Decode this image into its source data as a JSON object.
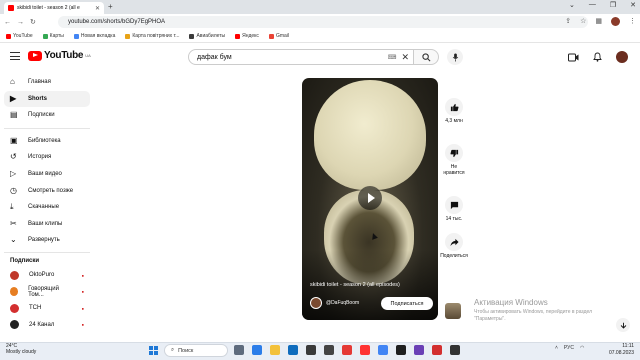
{
  "browser": {
    "tab_title": "skibidi toilet - season 2 (all e",
    "url": "youtube.com/shorts/bGDy7EgPHOA",
    "bookmarks": [
      {
        "label": "YouTube",
        "color": "#ff0000"
      },
      {
        "label": "Карты",
        "color": "#34a853"
      },
      {
        "label": "Новая вкладка",
        "color": "#4285f4"
      },
      {
        "label": "Карта повітряних т...",
        "color": "#e8a317"
      },
      {
        "label": "Авиабилеты",
        "color": "#3b3b3b"
      },
      {
        "label": "Яндекс",
        "color": "#ff0000"
      },
      {
        "label": "Gmail",
        "color": "#ea4335"
      }
    ]
  },
  "header": {
    "logo_text": "YouTube",
    "logo_region": "UA",
    "search_value": "дафак бум",
    "keyboard_icon": "keyboard-icon"
  },
  "sidebar": {
    "main": [
      {
        "label": "Главная",
        "icon": "home-icon"
      },
      {
        "label": "Shorts",
        "icon": "shorts-icon",
        "active": true
      },
      {
        "label": "Подписки",
        "icon": "subscriptions-icon"
      }
    ],
    "library": [
      {
        "label": "Библиотека",
        "icon": "library-icon"
      },
      {
        "label": "История",
        "icon": "history-icon"
      },
      {
        "label": "Ваши видео",
        "icon": "your-videos-icon"
      },
      {
        "label": "Смотреть позже",
        "icon": "watch-later-icon"
      },
      {
        "label": "Скачанные",
        "icon": "downloads-icon"
      },
      {
        "label": "Ваши клипы",
        "icon": "clips-icon"
      },
      {
        "label": "Развернуть",
        "icon": "chevron-down-icon"
      }
    ],
    "subscriptions_title": "Подписки",
    "subscriptions": [
      {
        "label": "OktoPuro",
        "color": "#c0392b"
      },
      {
        "label": "Говорящий Том...",
        "color": "#e67e22"
      },
      {
        "label": "ТСН",
        "color": "#d32f2f"
      },
      {
        "label": "24 Канал",
        "color": "#222222"
      }
    ]
  },
  "short": {
    "title": "skibidi toilet - season 2 (all episodes)",
    "channel": "@DaFuqBoom",
    "subscribe_label": "Подписаться"
  },
  "actions": {
    "likes": "4,3 млн",
    "dislike": "Не нравится",
    "comments": "14 тыс.",
    "share": "Поделиться"
  },
  "watermark": {
    "title": "Активация Windows",
    "text": "Чтобы активировать Windows, перейдите в раздел \"Параметры\"."
  },
  "taskbar": {
    "temp": "24°C",
    "weather": "Mostly cloudy",
    "search_label": "Поиск",
    "lang": "РУС",
    "time": "11:11",
    "date": "07.08.2023"
  }
}
